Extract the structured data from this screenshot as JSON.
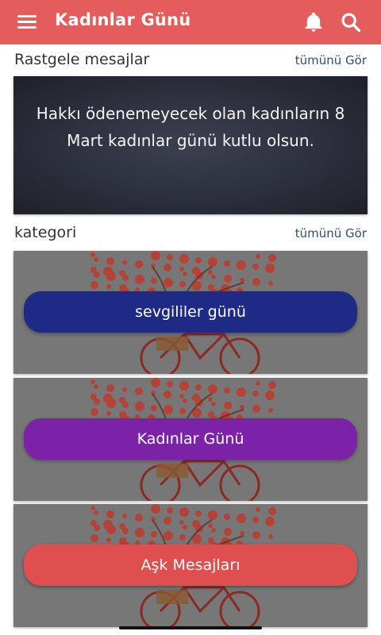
{
  "appbar": {
    "title": "Kadınlar Günü",
    "menu_icon": "hamburger-menu-icon",
    "notification_icon": "bell-icon",
    "search_icon": "search-icon",
    "color": "#e45c5c"
  },
  "random_section": {
    "title": "Rastgele mesajlar",
    "see_all": "tümünü Gör",
    "card_text": "Hakkı ödenemeyecek olan kadınların 8 Mart kadınlar günü kutlu olsun."
  },
  "category_section": {
    "title": "kategori",
    "see_all": "tümünü Gör",
    "items": [
      {
        "label": "sevgililer günü",
        "color": "#1e2a86"
      },
      {
        "label": "Kadınlar Günü",
        "color": "#7b22a8"
      },
      {
        "label": "Aşk Mesajları",
        "color": "#df4f4f"
      }
    ]
  }
}
